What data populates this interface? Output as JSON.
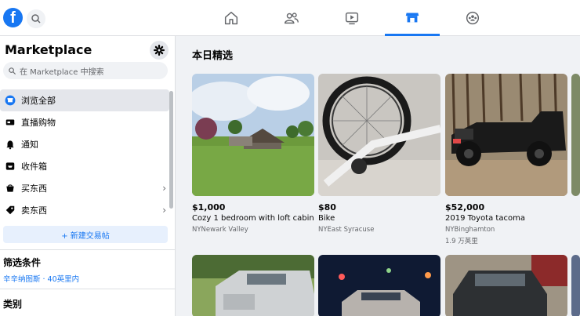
{
  "top_nav": {
    "logo": "f",
    "tabs": [
      {
        "name": "home",
        "icon": "home-icon"
      },
      {
        "name": "friends",
        "icon": "friends-icon"
      },
      {
        "name": "watch",
        "icon": "watch-icon"
      },
      {
        "name": "marketplace",
        "icon": "marketplace-icon",
        "active": true
      },
      {
        "name": "groups",
        "icon": "groups-icon"
      }
    ],
    "accent": "#1877f2"
  },
  "sidebar": {
    "title": "Marketplace",
    "search_placeholder": "在 Marketplace 中搜索",
    "items": [
      {
        "label": "浏览全部",
        "icon": "browse-icon",
        "active": true
      },
      {
        "label": "直播购物",
        "icon": "live-icon"
      },
      {
        "label": "通知",
        "icon": "bell-icon"
      },
      {
        "label": "收件箱",
        "icon": "inbox-icon"
      },
      {
        "label": "买东西",
        "icon": "buy-icon",
        "chevron": "›"
      },
      {
        "label": "卖东西",
        "icon": "sell-icon",
        "chevron": "›"
      }
    ],
    "new_listing": "+ 新建交易帖",
    "filter_title": "筛选条件",
    "location": "辛辛纳图斯 · 40英里内",
    "category_title": "类别"
  },
  "main": {
    "section_title": "本日精选",
    "listings": [
      {
        "price": "$1,000",
        "title": "Cozy 1 bedroom with loft cabin",
        "location": "NYNewark Valley"
      },
      {
        "price": "$80",
        "title": "Bike",
        "location": "NYEast Syracuse"
      },
      {
        "price": "$52,000",
        "title": "2019 Toyota tacoma",
        "location": "NYBinghamton",
        "mileage": "1.9 万英里"
      }
    ]
  }
}
